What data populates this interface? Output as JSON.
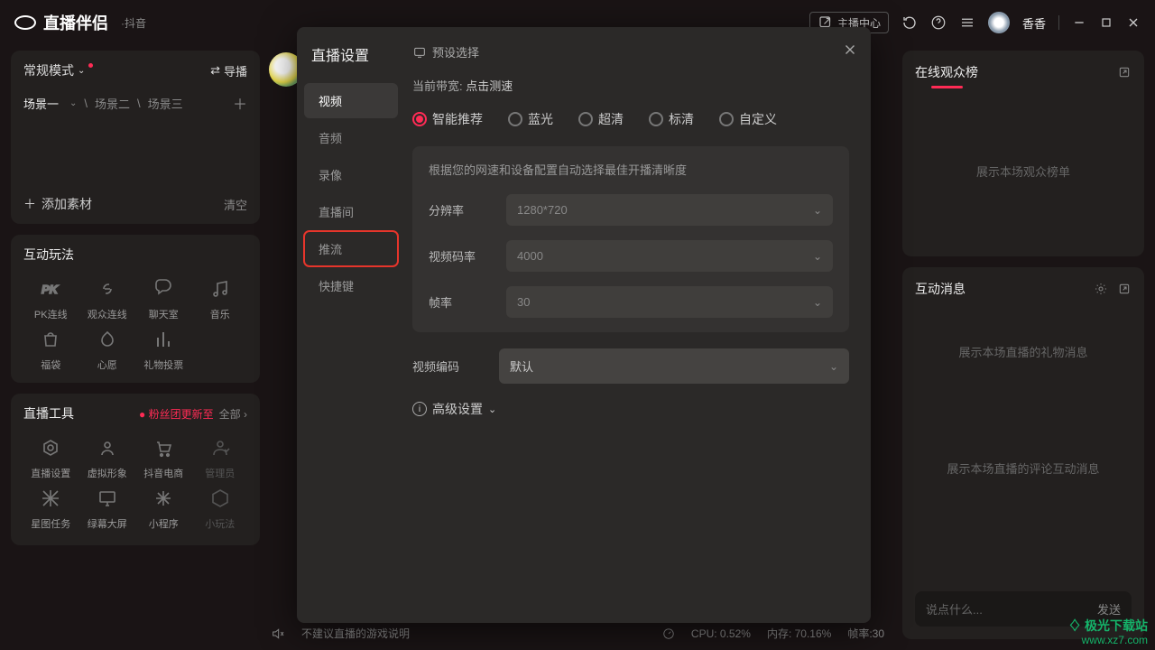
{
  "app": {
    "title": "直播伴侣",
    "sub": "·抖音"
  },
  "topbar": {
    "center": "主播中心",
    "user": "香香"
  },
  "left": {
    "mode": "常规模式",
    "daobo": "导播",
    "scenes": [
      "场景一",
      "场景二",
      "场景三"
    ],
    "add_material": "添加素材",
    "clear": "清空"
  },
  "inter": {
    "title": "互动玩法",
    "items": [
      {
        "label": "PK连线",
        "icon": "pk"
      },
      {
        "label": "观众连线",
        "icon": "link"
      },
      {
        "label": "聊天室",
        "icon": "chat"
      },
      {
        "label": "音乐",
        "icon": "music"
      },
      {
        "label": "福袋",
        "icon": "bag"
      },
      {
        "label": "心愿",
        "icon": "wish"
      },
      {
        "label": "礼物投票",
        "icon": "vote"
      }
    ]
  },
  "tools": {
    "title": "直播工具",
    "update": "粉丝团更新至",
    "all": "全部",
    "items": [
      {
        "label": "直播设置",
        "icon": "gear"
      },
      {
        "label": "虚拟形象",
        "icon": "avatar"
      },
      {
        "label": "抖音电商",
        "icon": "cart"
      },
      {
        "label": "管理员",
        "icon": "admin",
        "dim": true
      },
      {
        "label": "星图任务",
        "icon": "star"
      },
      {
        "label": "绿幕大屏",
        "icon": "screen"
      },
      {
        "label": "小程序",
        "icon": "mini"
      },
      {
        "label": "小玩法",
        "icon": "play",
        "dim": true
      }
    ]
  },
  "status": {
    "warn": "不建议直播的游戏说明",
    "cpu": "CPU: 0.52%",
    "mem": "内存: 70.16%",
    "fps": "帧率:30"
  },
  "right": {
    "audience_title": "在线观众榜",
    "audience_ph": "展示本场观众榜单",
    "msg_title": "互动消息",
    "gift_ph": "展示本场直播的礼物消息",
    "comment_ph": "展示本场直播的评论互动消息",
    "input_ph": "说点什么...",
    "send": "发送"
  },
  "modal": {
    "title": "直播设置",
    "tabs": [
      "视频",
      "音频",
      "录像",
      "直播间",
      "推流",
      "快捷键"
    ],
    "preset": "预设选择",
    "bandwidth_label": "当前带宽:",
    "bandwidth_action": "点击测速",
    "radios": [
      "智能推荐",
      "蓝光",
      "超清",
      "标清",
      "自定义"
    ],
    "desc": "根据您的网速和设备配置自动选择最佳开播清晰度",
    "fields": {
      "resolution": {
        "label": "分辨率",
        "value": "1280*720"
      },
      "bitrate": {
        "label": "视频码率",
        "value": "4000"
      },
      "fps": {
        "label": "帧率",
        "value": "30"
      },
      "codec": {
        "label": "视频编码",
        "value": "默认"
      }
    },
    "advanced": "高级设置"
  },
  "watermark": {
    "line1": "极光下载站",
    "line2": "www.xz7.com"
  }
}
